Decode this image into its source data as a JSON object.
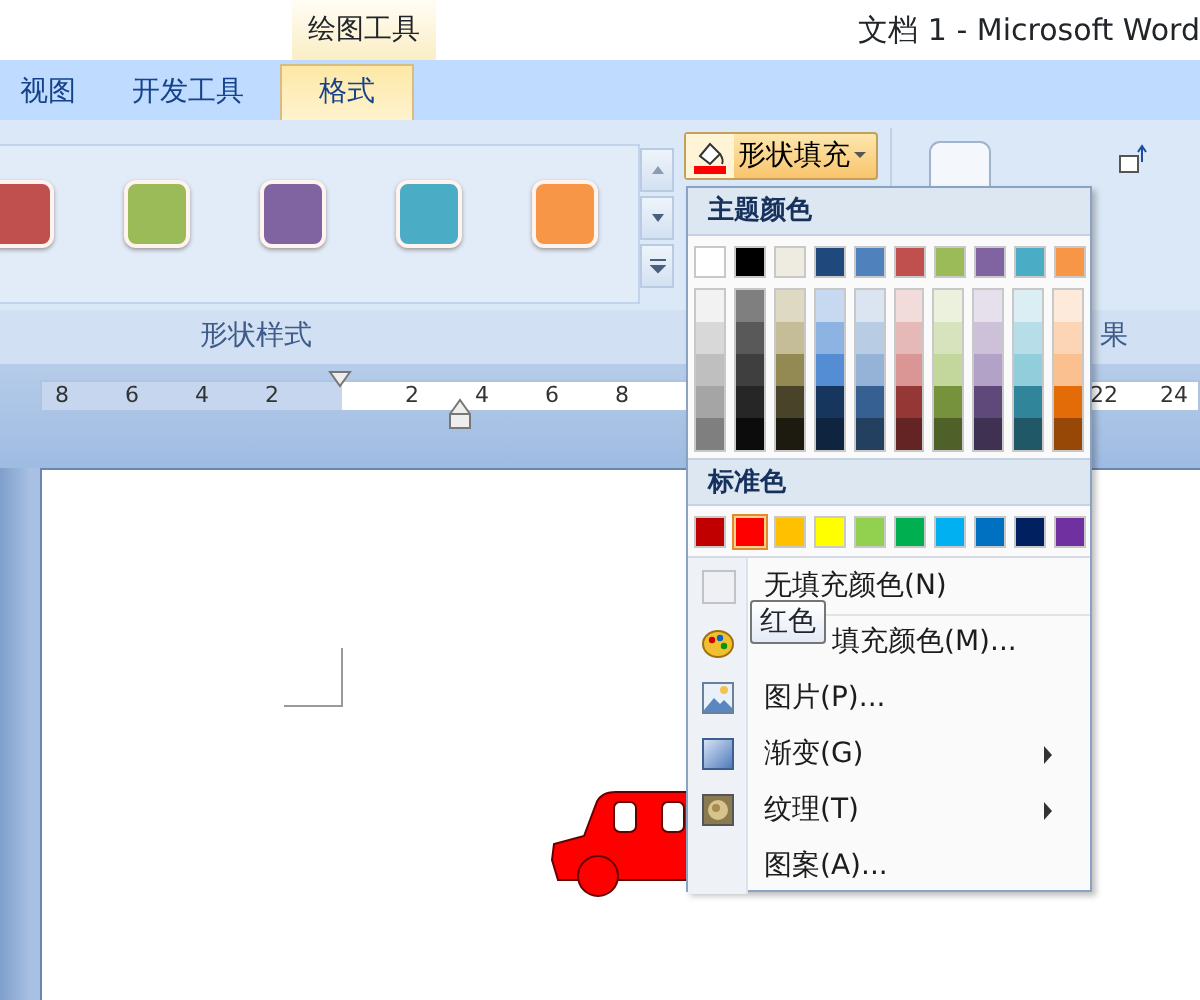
{
  "title_bar": {
    "context_tab": "绘图工具",
    "title": "文档 1 - Microsoft Word"
  },
  "tabs": [
    {
      "label": "视图",
      "selected": false
    },
    {
      "label": "开发工具",
      "selected": false
    },
    {
      "label": "格式",
      "selected": true
    }
  ],
  "ribbon": {
    "style_gallery": [
      {
        "color": "#c0504d"
      },
      {
        "color": "#9bbb59"
      },
      {
        "color": "#8064a2"
      },
      {
        "color": "#4bacc6"
      },
      {
        "color": "#f79646"
      }
    ],
    "style_group_label": "形状样式",
    "fill_button": {
      "label": "形状填充",
      "color": "#ff0000"
    },
    "effects_group_label": "果"
  },
  "ruler": {
    "labels": [
      "8",
      "6",
      "4",
      "2",
      "2",
      "4",
      "6",
      "8",
      "22",
      "24"
    ]
  },
  "fill_menu": {
    "theme_header": "主题颜色",
    "theme_colors": [
      {
        "color": "#ffffff",
        "shades": [
          {
            "color": "#f2f2f2"
          },
          {
            "color": "#d8d8d8"
          },
          {
            "color": "#bfbfbf"
          },
          {
            "color": "#a5a5a5"
          },
          {
            "color": "#7f7f7f"
          }
        ]
      },
      {
        "color": "#000000",
        "shades": [
          {
            "color": "#7f7f7f"
          },
          {
            "color": "#595959"
          },
          {
            "color": "#3f3f3f"
          },
          {
            "color": "#262626"
          },
          {
            "color": "#0c0c0c"
          }
        ]
      },
      {
        "color": "#eeece1",
        "shades": [
          {
            "color": "#ddd9c3"
          },
          {
            "color": "#c4bd97"
          },
          {
            "color": "#938953"
          },
          {
            "color": "#494429"
          },
          {
            "color": "#1d1b10"
          }
        ]
      },
      {
        "color": "#1f497d",
        "shades": [
          {
            "color": "#c6d9f0"
          },
          {
            "color": "#8db3e2"
          },
          {
            "color": "#548dd4"
          },
          {
            "color": "#17365d"
          },
          {
            "color": "#0f243e"
          }
        ]
      },
      {
        "color": "#4f81bd",
        "shades": [
          {
            "color": "#dbe5f1"
          },
          {
            "color": "#b8cce4"
          },
          {
            "color": "#95b3d7"
          },
          {
            "color": "#366092"
          },
          {
            "color": "#244061"
          }
        ]
      },
      {
        "color": "#c0504d",
        "shades": [
          {
            "color": "#f2dcdb"
          },
          {
            "color": "#e5b9b7"
          },
          {
            "color": "#d99694"
          },
          {
            "color": "#953734"
          },
          {
            "color": "#632423"
          }
        ]
      },
      {
        "color": "#9bbb59",
        "shades": [
          {
            "color": "#ebf1dd"
          },
          {
            "color": "#d7e3bc"
          },
          {
            "color": "#c3d69b"
          },
          {
            "color": "#76923c"
          },
          {
            "color": "#4f6128"
          }
        ]
      },
      {
        "color": "#8064a2",
        "shades": [
          {
            "color": "#e5e0ec"
          },
          {
            "color": "#ccc1d9"
          },
          {
            "color": "#b2a2c7"
          },
          {
            "color": "#5f497a"
          },
          {
            "color": "#3f3151"
          }
        ]
      },
      {
        "color": "#4bacc6",
        "shades": [
          {
            "color": "#dbeef3"
          },
          {
            "color": "#b7dde8"
          },
          {
            "color": "#92cddc"
          },
          {
            "color": "#31859b"
          },
          {
            "color": "#205867"
          }
        ]
      },
      {
        "color": "#f79646",
        "shades": [
          {
            "color": "#fdeada"
          },
          {
            "color": "#fbd5b5"
          },
          {
            "color": "#fac08f"
          },
          {
            "color": "#e36c09"
          },
          {
            "color": "#974806"
          }
        ]
      }
    ],
    "standard_header": "标准色",
    "standard_colors": [
      {
        "color": "#c00000",
        "selected": false
      },
      {
        "color": "#ff0000",
        "selected": true
      },
      {
        "color": "#ffc000",
        "selected": false
      },
      {
        "color": "#ffff00",
        "selected": false
      },
      {
        "color": "#92d050",
        "selected": false
      },
      {
        "color": "#00b050",
        "selected": false
      },
      {
        "color": "#00b0f0",
        "selected": false
      },
      {
        "color": "#0070c0",
        "selected": false
      },
      {
        "color": "#002060",
        "selected": false
      },
      {
        "color": "#7030a0",
        "selected": false
      }
    ],
    "items": [
      {
        "label": "无填充颜色(N)",
        "submenu": false
      },
      {
        "label": "填充颜色(M)...",
        "submenu": false
      },
      {
        "label": "图片(P)...",
        "submenu": false
      },
      {
        "label": "渐变(G)",
        "submenu": true
      },
      {
        "label": "纹理(T)",
        "submenu": true
      },
      {
        "label": "图案(A)...",
        "submenu": false
      }
    ]
  },
  "tooltip": "红色"
}
